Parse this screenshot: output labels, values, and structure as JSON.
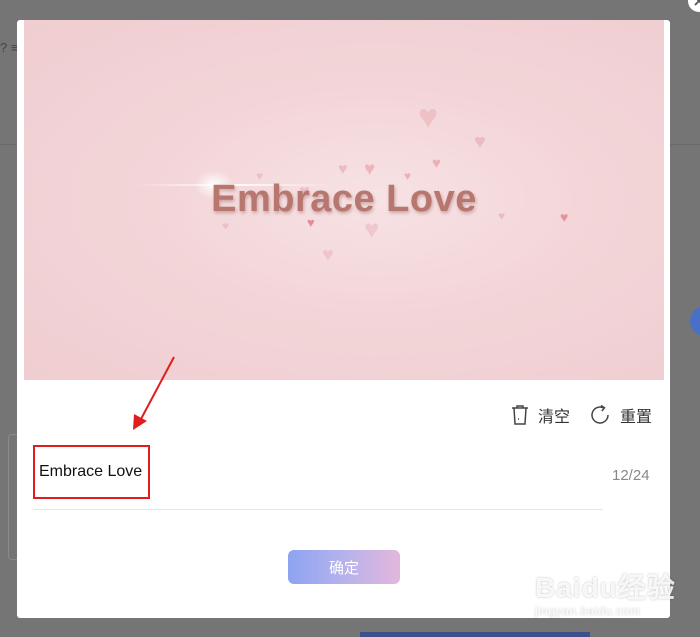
{
  "background": {
    "toolbar_glyphs": [
      "?",
      "≡"
    ]
  },
  "modal": {
    "preview": {
      "title": "Embrace Love",
      "background_color": "#f3d5d8",
      "text_color": "#b7776e"
    },
    "actions": {
      "clear": {
        "label": "清空",
        "icon": "trash-icon"
      },
      "reset": {
        "label": "重置",
        "icon": "refresh-icon"
      }
    },
    "input": {
      "value": "Embrace Love",
      "counter": "12/24",
      "highlight_color": "#e01e1e"
    },
    "confirm": {
      "label": "确定"
    }
  },
  "annotation": {
    "arrow_color": "#e01e1e"
  },
  "watermark": {
    "main": "Baidu经验",
    "sub": "jingyan.baidu.com"
  }
}
